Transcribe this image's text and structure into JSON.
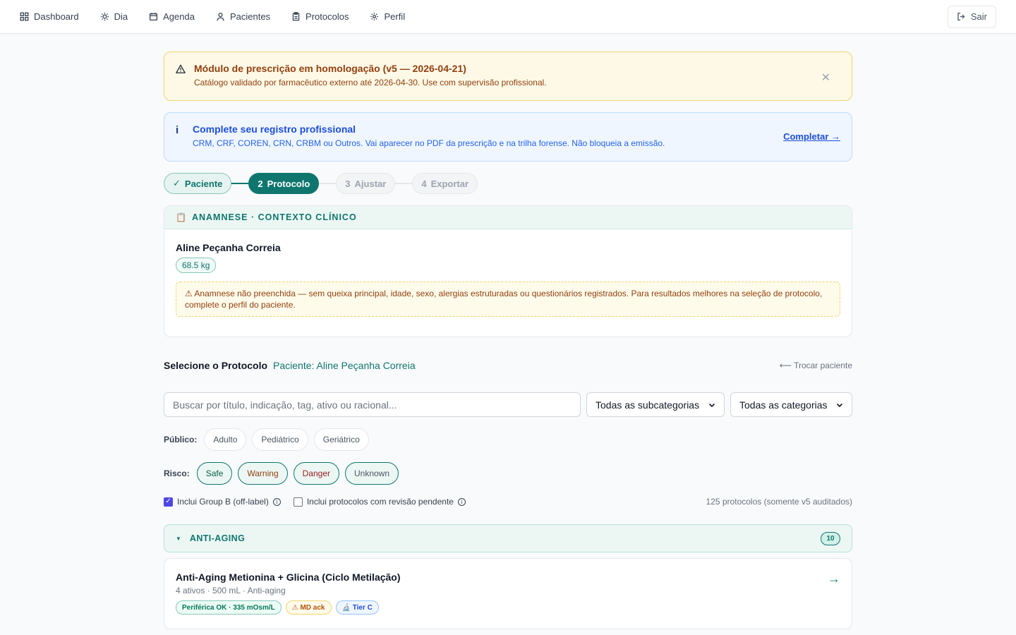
{
  "nav": {
    "items": [
      {
        "label": "Dashboard",
        "icon": "grid-icon"
      },
      {
        "label": "Dia",
        "icon": "sun-icon"
      },
      {
        "label": "Agenda",
        "icon": "calendar-icon"
      },
      {
        "label": "Pacientes",
        "icon": "user-icon"
      },
      {
        "label": "Protocolos",
        "icon": "clipboard-icon"
      },
      {
        "label": "Perfil",
        "icon": "gear-icon"
      }
    ],
    "logout_label": "Sair"
  },
  "warning_banner": {
    "title": "Módulo de prescrição em homologação (v5 — 2026-04-21)",
    "subtitle": "Catálogo validado por farmacêutico externo até 2026-04-30. Use com supervisão profissional.",
    "close_glyph": "✕"
  },
  "info_banner": {
    "icon_glyph": "i",
    "title": "Complete seu registro profissional",
    "subtitle": "CRM, CRF, COREN, CRN, CRBM ou Outros. Vai aparecer no PDF da prescrição e na trilha forense. Não bloqueia a emissão.",
    "link": "Completar →"
  },
  "stepper": {
    "steps": [
      {
        "prefix": "✓",
        "label": "Paciente",
        "state": "done"
      },
      {
        "prefix": "2",
        "label": "Protocolo",
        "state": "active"
      },
      {
        "prefix": "3",
        "label": "Ajustar",
        "state": "todo"
      },
      {
        "prefix": "4",
        "label": "Exportar",
        "state": "todo"
      }
    ]
  },
  "anamnese": {
    "header": "ANAMNESE · CONTEXTO CLÍNICO",
    "header_icon": "📋",
    "patient_name": "Aline Peçanha Correia",
    "weight": "68.5 kg",
    "warning": "⚠ Anamnese não preenchida — sem queixa principal, idade, sexo, alergias estruturadas ou questionários registrados. Para resultados melhores na seleção de protocolo, complete o perfil do paciente."
  },
  "selector": {
    "title": "Selecione o Protocolo",
    "patient": "Paciente: Aline Peçanha Correia",
    "swap": "⟵ Trocar paciente",
    "search_placeholder": "Buscar por título, indicação, tag, ativo ou racional...",
    "subcategory_value": "Todas as subcategorias",
    "category_value": "Todas as categorias",
    "public_label": "Público:",
    "public_options": [
      "Adulto",
      "Pediátrico",
      "Geriátrico"
    ],
    "risk_label": "Risco:",
    "risk_options": [
      "Safe",
      "Warning",
      "Danger",
      "Unknown"
    ],
    "include_group_b": "Inclui Group B (off-label)",
    "include_pending": "Inclui protocolos com revisão pendente",
    "info_glyph": "i",
    "count": "125 protocolos (somente v5 auditados)"
  },
  "group": {
    "toggle_glyph": "▼",
    "name": "ANTI-AGING",
    "count": "10"
  },
  "protocol": {
    "name": "Anti-Aging Metionina + Glicina (Ciclo Metilação)",
    "meta": "4 ativos · 500 mL · Anti-aging",
    "arrow": "→",
    "tags": [
      "Periférica OK · 335 mOsm/L",
      "⚠ MD ack",
      "🔬 Tier C"
    ]
  },
  "colors": {
    "accent": "#0f766e",
    "warning_bg": "#fef9e7",
    "info_bg": "#eff6ff"
  }
}
